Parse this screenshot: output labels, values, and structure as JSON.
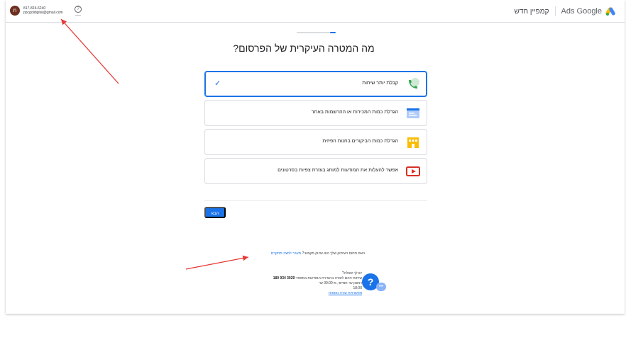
{
  "header": {
    "avatar_letter": "n",
    "account_phone": "817-824-6240",
    "account_email": "ppcgoldigital@gmail.com",
    "help_icon": "help-circle-icon",
    "brand_name": "Ads Google",
    "campaign_label": "קמפיין חדש"
  },
  "progress": {
    "fraction": 0.15
  },
  "page": {
    "title": "מה המטרה העיקרית של הפרסום?"
  },
  "options": [
    {
      "label": "קבלת יותר שיחות",
      "icon": "phone-icon",
      "selected": true
    },
    {
      "label": "הגדלת כמות המכירות או ההרשמות באתר",
      "icon": "browser-window-icon",
      "selected": false
    },
    {
      "label": "הגדלת כמות הביקורים בחנות הפיזית",
      "icon": "storefront-icon",
      "selected": false
    },
    {
      "label": "אפשר להעלות את המודעות למותג בעזרת צפיות בסרטונים",
      "icon": "video-play-icon",
      "selected": false
    }
  ],
  "next_button": {
    "label": "הבא"
  },
  "switch": {
    "question": "האם תחום העיסוק שלך הוא שיווק מקצועי?",
    "link": "מעבר למצב מתקדם"
  },
  "help": {
    "title": "יש לך שאלה?",
    "line1_prefix": "שיחות חינם לעזרה בהגדרת המודעות במספר",
    "phone": "3029 934 180",
    "line2": "ראשון עד חמישי, מ-09:00 עד",
    "line3": "18:00",
    "more_link": "אפשרויות עזרה נוספות"
  },
  "colors": {
    "accent": "#1a73e8",
    "arrow": "#e53935",
    "phone_green": "#34a853",
    "store_yellow": "#fbbc04",
    "video_red": "#d93025"
  }
}
